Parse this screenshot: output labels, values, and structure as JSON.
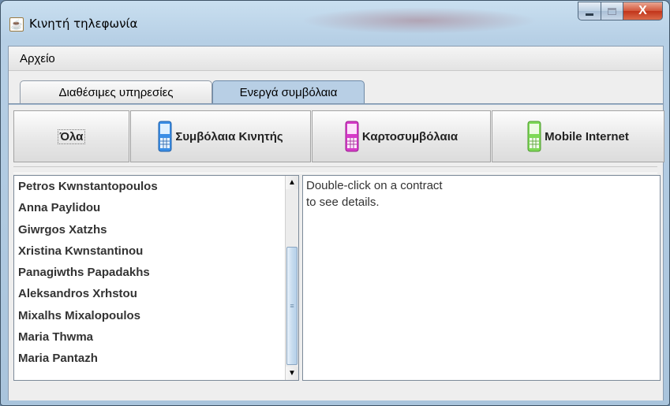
{
  "window": {
    "title": "Κινητή τηλεφωνία",
    "close_glyph": "X"
  },
  "menubar": {
    "items": [
      "Αρχείο"
    ]
  },
  "tabs": [
    {
      "label": "Διαθέσιμες υπηρεσίες",
      "selected": false
    },
    {
      "label": "Ενεργά συμβόλαια",
      "selected": true
    }
  ],
  "toolbar": {
    "buttons": [
      {
        "label": "Όλα",
        "icon": null
      },
      {
        "label": "Συμβόλαια Κινητής",
        "icon": "mobile-phone-blue-icon",
        "color": "#3a8ee6"
      },
      {
        "label": "Καρτοσυμβόλαια",
        "icon": "mobile-phone-magenta-icon",
        "color": "#d63ac8"
      },
      {
        "label": "Mobile Internet",
        "icon": "mobile-phone-green-icon",
        "color": "#7ed957"
      }
    ]
  },
  "contracts": [
    "Petros Kwnstantopoulos",
    "Anna Paylidou",
    "Giwrgos Xatzhs",
    "Xristina Kwnstantinou",
    "Panagiwths Papadakhs",
    "Aleksandros Xrhstou",
    "Mixalhs Mixalopoulos",
    "Maria Thwma",
    "Maria Pantazh"
  ],
  "details": {
    "text": "Double-click on a contract\nto see details."
  }
}
